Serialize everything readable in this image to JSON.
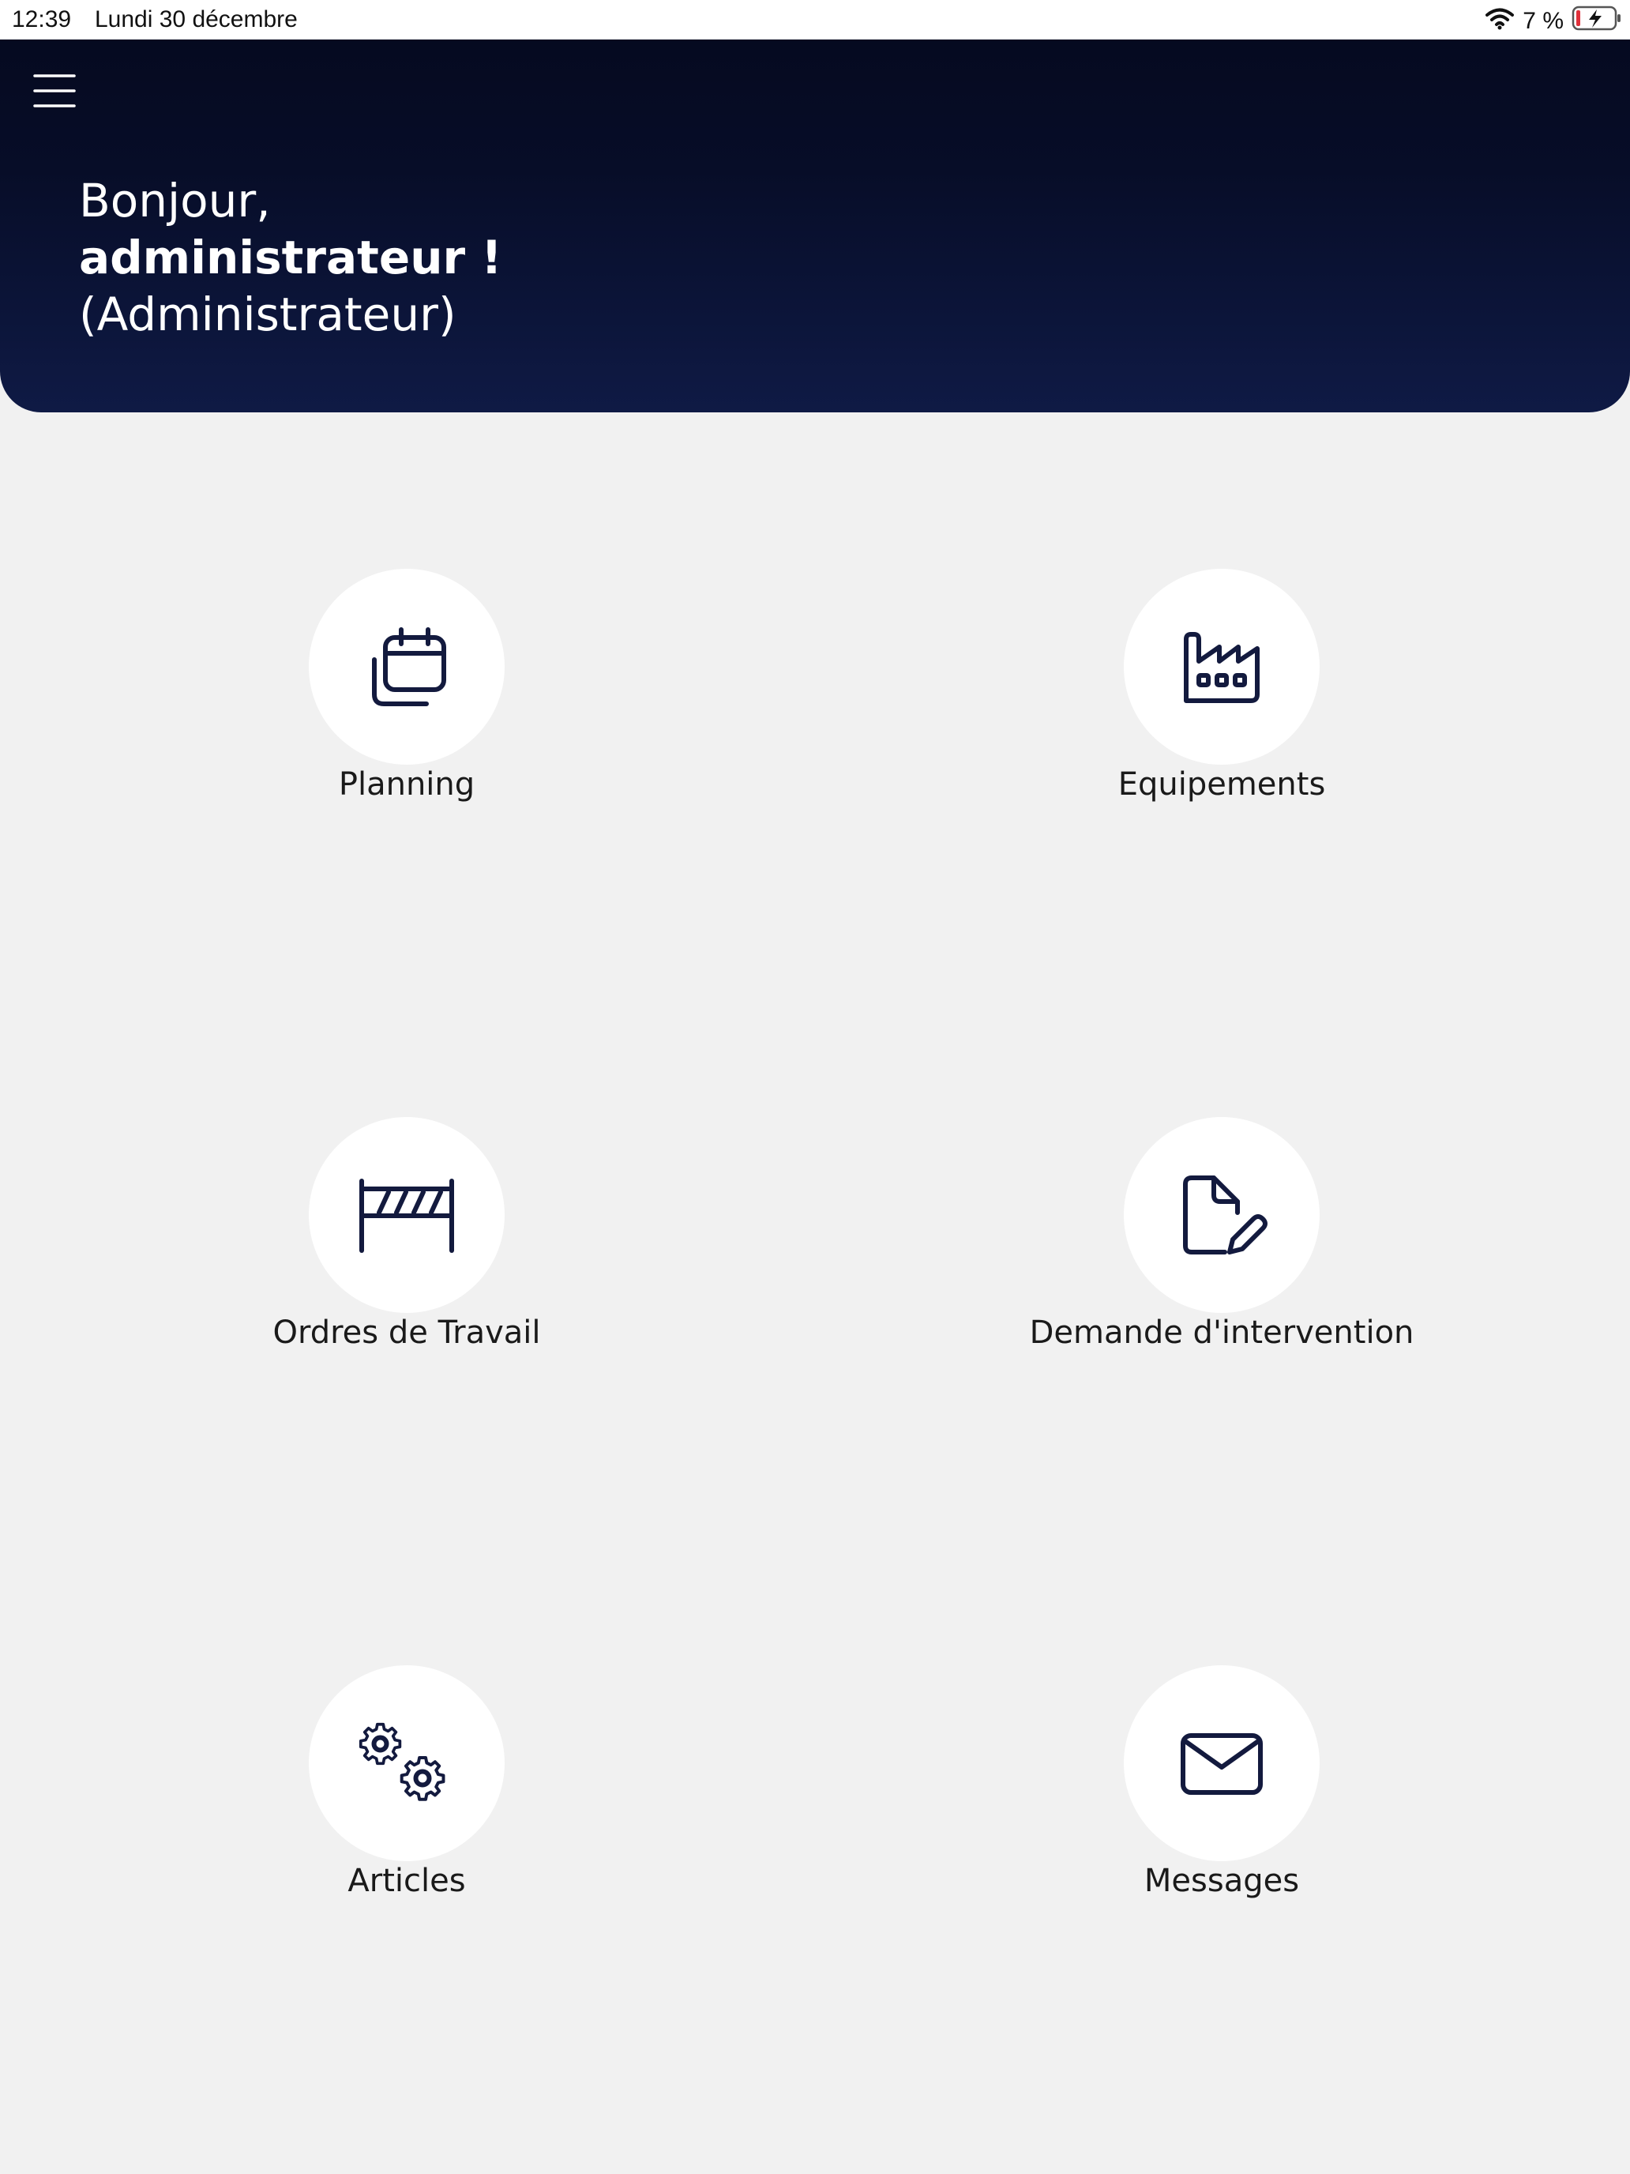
{
  "status_bar": {
    "time": "12:39",
    "date": "Lundi 30 décembre",
    "battery_percent": "7 %",
    "icons": [
      "wifi-icon",
      "battery-charging-icon"
    ]
  },
  "header": {
    "menu_icon": "hamburger-menu-icon",
    "greeting_line1": "Bonjour,",
    "greeting_name": "administrateur !",
    "greeting_role": "(Administrateur)"
  },
  "tiles": [
    {
      "label": "Planning",
      "icon": "calendar-icon"
    },
    {
      "label": "Equipements",
      "icon": "factory-icon"
    },
    {
      "label": "Ordres de Travail",
      "icon": "barrier-icon"
    },
    {
      "label": "Demande d'intervention",
      "icon": "document-edit-icon"
    },
    {
      "label": "Articles",
      "icon": "gears-icon"
    },
    {
      "label": "Messages",
      "icon": "mail-icon"
    }
  ],
  "colors": {
    "header_dark": "#050a20",
    "header_light": "#0f1a45",
    "icon_stroke": "#131a3e",
    "background": "#f1f1f1",
    "tile_circle": "#ffffff",
    "battery_low": "#e0303a"
  }
}
